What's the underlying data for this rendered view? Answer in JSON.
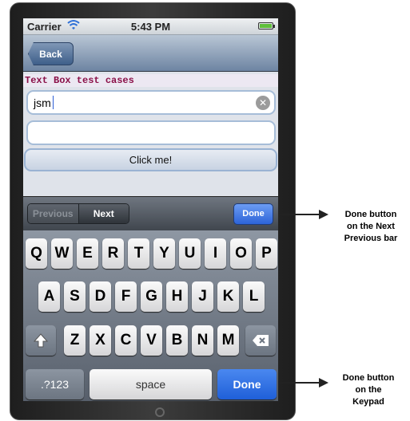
{
  "status_bar": {
    "carrier": "Carrier",
    "time": "5:43 PM"
  },
  "nav_bar": {
    "back_label": "Back"
  },
  "content": {
    "heading": "Text Box test cases",
    "textbox1_value": "jsm",
    "textbox2_value": "",
    "click_button_label": "Click me!"
  },
  "accessory_bar": {
    "previous_label": "Previous",
    "next_label": "Next",
    "done_label": "Done"
  },
  "keyboard": {
    "row1": [
      "Q",
      "W",
      "E",
      "R",
      "T",
      "Y",
      "U",
      "I",
      "O",
      "P"
    ],
    "row2": [
      "A",
      "S",
      "D",
      "F",
      "G",
      "H",
      "J",
      "K",
      "L"
    ],
    "row3": [
      "Z",
      "X",
      "C",
      "V",
      "B",
      "N",
      "M"
    ],
    "numbers_label": ".?123",
    "space_label": "space",
    "done_label": "Done"
  },
  "annotations": {
    "accessory_done": [
      "Done button",
      "on the Next",
      "Previous bar"
    ],
    "keypad_done": [
      "Done button",
      "on the",
      "Keypad"
    ]
  }
}
